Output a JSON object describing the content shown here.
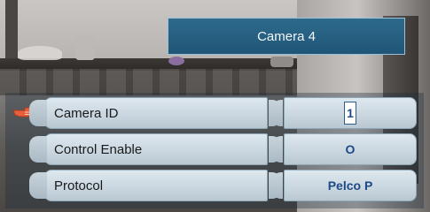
{
  "title": "Camera 4",
  "menu": [
    {
      "label": "Camera ID",
      "value": "1"
    },
    {
      "label": "Control Enable",
      "value": "O"
    },
    {
      "label": "Protocol",
      "value": "Pelco P"
    }
  ],
  "selected_index": 0,
  "colors": {
    "title_bg": "#1f5677",
    "row_bg": "#c9d6df",
    "value_text": "#1d4a86",
    "cursor": "#e8603a"
  }
}
